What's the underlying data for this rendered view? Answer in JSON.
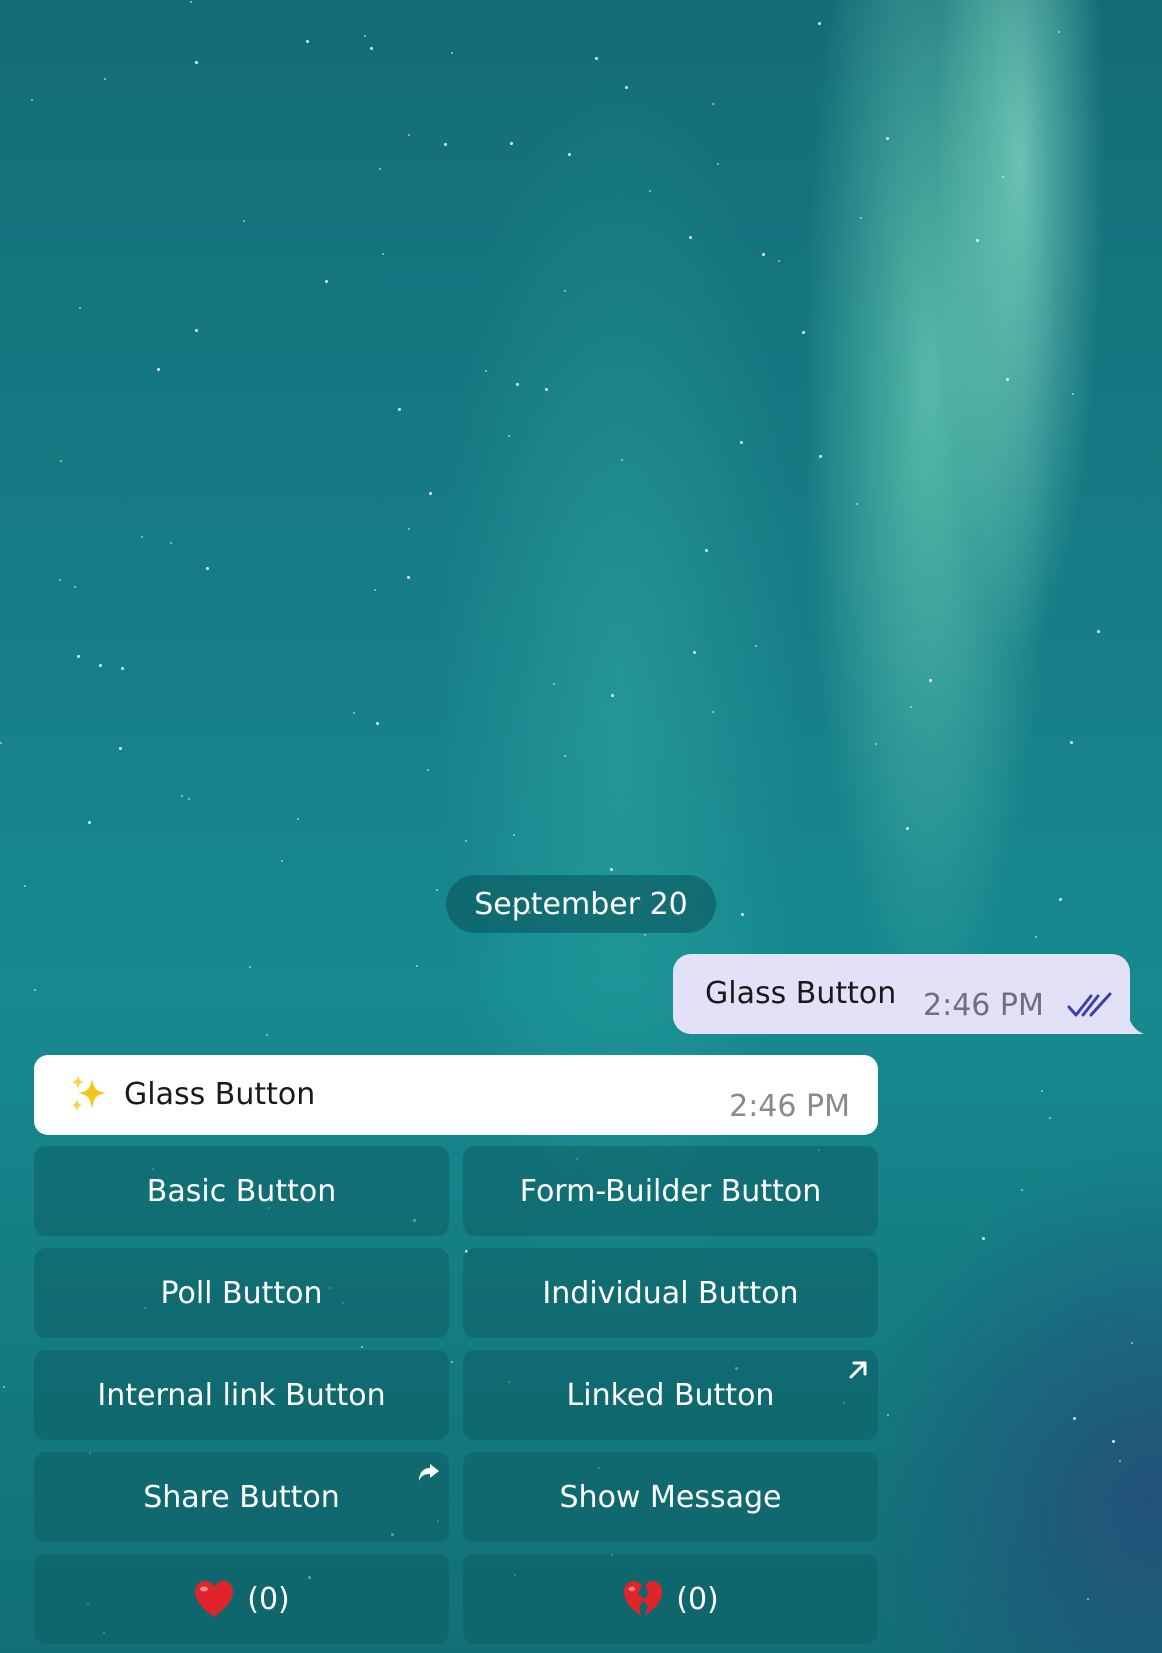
{
  "chat": {
    "date_separator": "September 20",
    "outgoing_message": {
      "text": "Glass Button",
      "time": "2:46 PM",
      "status_icon": "double-check-icon"
    },
    "incoming_message": {
      "emoji_icon": "sparkles-icon",
      "text": "Glass Button",
      "time": "2:46 PM"
    }
  },
  "inline_keyboard": {
    "rows": [
      [
        {
          "label": "Basic Button"
        },
        {
          "label": "Form-Builder Button"
        }
      ],
      [
        {
          "label": "Poll Button"
        },
        {
          "label": "Individual Button"
        }
      ],
      [
        {
          "label": "Internal link Button"
        },
        {
          "label": "Linked Button",
          "corner_icon": "external-link-arrow-icon"
        }
      ],
      [
        {
          "label": "Share Button",
          "corner_icon": "share-arrow-icon"
        },
        {
          "label": "Show Message"
        }
      ],
      [
        {
          "icon": "red-heart-icon",
          "count": "(0)"
        },
        {
          "icon": "broken-heart-icon",
          "count": "(0)"
        }
      ]
    ]
  },
  "colors": {
    "outgoing_bubble": "#e3e1f7",
    "incoming_bubble": "#ffffff",
    "check_marks": "#3b3fb0",
    "keyboard_button": "#0c5f64"
  }
}
